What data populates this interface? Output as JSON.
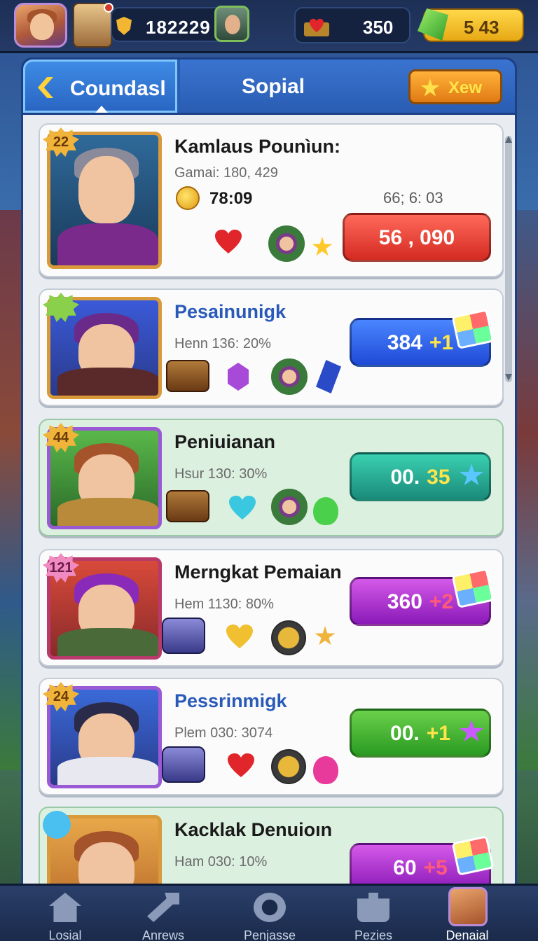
{
  "topbar": {
    "coins": "182229",
    "hearts": "350",
    "gems": "5 43"
  },
  "tabs": {
    "council": "Coundasl",
    "social": "Sopial",
    "new_button": "Xew"
  },
  "cards": [
    {
      "level": "22",
      "title": "Kamlaus Pounìun:",
      "subtitle": "Gamai: 180, 429",
      "timer": "78:09",
      "right_stat": "66; 6: 03",
      "button": "56 , 090",
      "button_accent": "",
      "button_color": "red"
    },
    {
      "level": "",
      "title": "Pesainunigk",
      "subtitle": "Henn 136: 20%",
      "button": "384",
      "button_accent": "+1",
      "button_color": "blue"
    },
    {
      "level": "44",
      "title": "Peniuianan",
      "subtitle": "Hsur 130: 30%",
      "button": "00.",
      "button_accent": "35",
      "button_color": "teal"
    },
    {
      "level": "121",
      "title": "Merngkat Pemaian",
      "subtitle": "Hem 1130: 80%",
      "button": "360",
      "button_accent": "+2",
      "button_color": "purple"
    },
    {
      "level": "24",
      "title": "Pessrinmigk",
      "subtitle": "Plem 030: 3074",
      "button": "00.",
      "button_accent": "+1",
      "button_color": "green"
    },
    {
      "level": "",
      "title": "Kacklak Denuioın",
      "subtitle": "Ham 030: 10%",
      "button": "60",
      "button_accent": "+5",
      "button_color": "purple"
    }
  ],
  "bottom_nav": [
    {
      "label": "Losial",
      "icon": "home-icon"
    },
    {
      "label": "Anrews",
      "icon": "wrench-icon"
    },
    {
      "label": "Penjasse",
      "icon": "gear-icon"
    },
    {
      "label": "Pezies",
      "icon": "puzzle-icon"
    },
    {
      "label": "Denaial",
      "icon": "avatar"
    }
  ]
}
